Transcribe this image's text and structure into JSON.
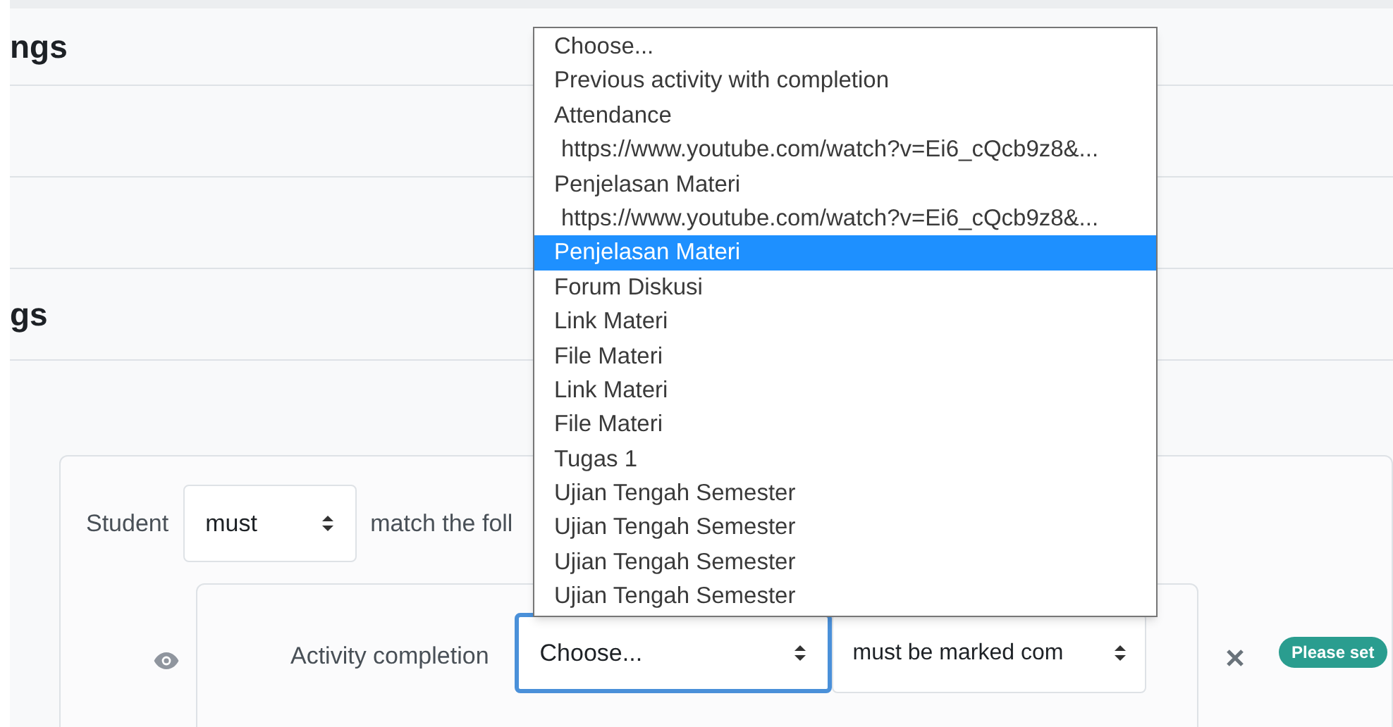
{
  "sections": [
    {
      "heading": "ngs"
    },
    {
      "heading": "gs"
    }
  ],
  "restriction": {
    "student_label": "Student",
    "must_select": "must",
    "match_text": "match the foll",
    "condition": {
      "label": "Activity completion",
      "activity_select": "Choose...",
      "focused": true,
      "completion_select": "must be marked com",
      "badge": "Please set"
    }
  },
  "dropdown": [
    {
      "label": "Choose...",
      "kind": "option",
      "selected": false
    },
    {
      "label": "Previous activity with completion",
      "kind": "option",
      "selected": false
    },
    {
      "label": "Attendance",
      "kind": "option",
      "selected": false
    },
    {
      "label": "https://www.youtube.com/watch?v=Ei6_cQcb9z8&...",
      "kind": "url",
      "selected": false
    },
    {
      "label": "Penjelasan Materi",
      "kind": "option",
      "selected": false
    },
    {
      "label": "https://www.youtube.com/watch?v=Ei6_cQcb9z8&...",
      "kind": "url",
      "selected": false
    },
    {
      "label": "Penjelasan Materi",
      "kind": "option",
      "selected": true
    },
    {
      "label": "Forum Diskusi",
      "kind": "option",
      "selected": false
    },
    {
      "label": "Link Materi",
      "kind": "option",
      "selected": false
    },
    {
      "label": "File Materi",
      "kind": "option",
      "selected": false
    },
    {
      "label": "Link Materi",
      "kind": "option",
      "selected": false
    },
    {
      "label": "File Materi",
      "kind": "option",
      "selected": false
    },
    {
      "label": "Tugas 1",
      "kind": "option",
      "selected": false
    },
    {
      "label": "Ujian Tengah Semester",
      "kind": "option",
      "selected": false
    },
    {
      "label": "Ujian Tengah Semester",
      "kind": "option",
      "selected": false
    },
    {
      "label": "Ujian Tengah Semester",
      "kind": "option",
      "selected": false
    },
    {
      "label": "Ujian Tengah Semester",
      "kind": "option",
      "selected": false
    }
  ]
}
